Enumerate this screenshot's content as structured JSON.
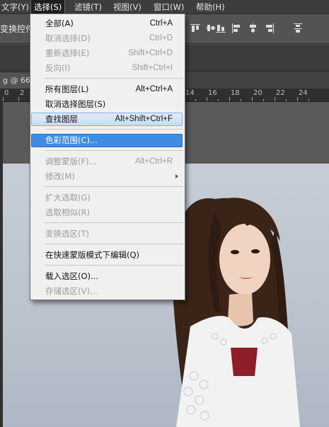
{
  "menubar": {
    "items": [
      {
        "label": "文字(Y)"
      },
      {
        "label": "选择(S)"
      },
      {
        "label": "滤镜(T)"
      },
      {
        "label": "视图(V)"
      },
      {
        "label": "窗口(W)"
      },
      {
        "label": "帮助(H)"
      }
    ]
  },
  "options": {
    "label": "变换控件"
  },
  "document": {
    "tab_label": "g @ 66.7"
  },
  "ruler": {
    "labels": [
      "0",
      "2",
      "14",
      "16",
      "18",
      "20",
      "22",
      "24"
    ]
  },
  "select_menu": {
    "items": [
      {
        "label": "全部(A)",
        "shortcut": "Ctrl+A",
        "enabled": true
      },
      {
        "label": "取消选择(D)",
        "shortcut": "Ctrl+D",
        "enabled": false
      },
      {
        "label": "重新选择(E)",
        "shortcut": "Shift+Ctrl+D",
        "enabled": false
      },
      {
        "label": "反向(I)",
        "shortcut": "Shift+Ctrl+I",
        "enabled": false
      },
      {
        "label": "所有图层(L)",
        "shortcut": "Alt+Ctrl+A",
        "enabled": true
      },
      {
        "label": "取消选择图层(S)",
        "shortcut": "",
        "enabled": true
      },
      {
        "label": "查找图层",
        "shortcut": "Alt+Shift+Ctrl+F",
        "enabled": true
      },
      {
        "label": "色彩范围(C)...",
        "shortcut": "",
        "enabled": true
      },
      {
        "label": "调整蒙版(F)...",
        "shortcut": "Alt+Ctrl+R",
        "enabled": false
      },
      {
        "label": "修改(M)",
        "shortcut": "",
        "enabled": false,
        "submenu": true
      },
      {
        "label": "扩大选取(G)",
        "shortcut": "",
        "enabled": false
      },
      {
        "label": "选取相似(R)",
        "shortcut": "",
        "enabled": false
      },
      {
        "label": "变换选区(T)",
        "shortcut": "",
        "enabled": false
      },
      {
        "label": "在快速蒙版模式下编辑(Q)",
        "shortcut": "",
        "enabled": true
      },
      {
        "label": "载入选区(O)...",
        "shortcut": "",
        "enabled": true
      },
      {
        "label": "存储选区(V)...",
        "shortcut": "",
        "enabled": false
      }
    ]
  }
}
